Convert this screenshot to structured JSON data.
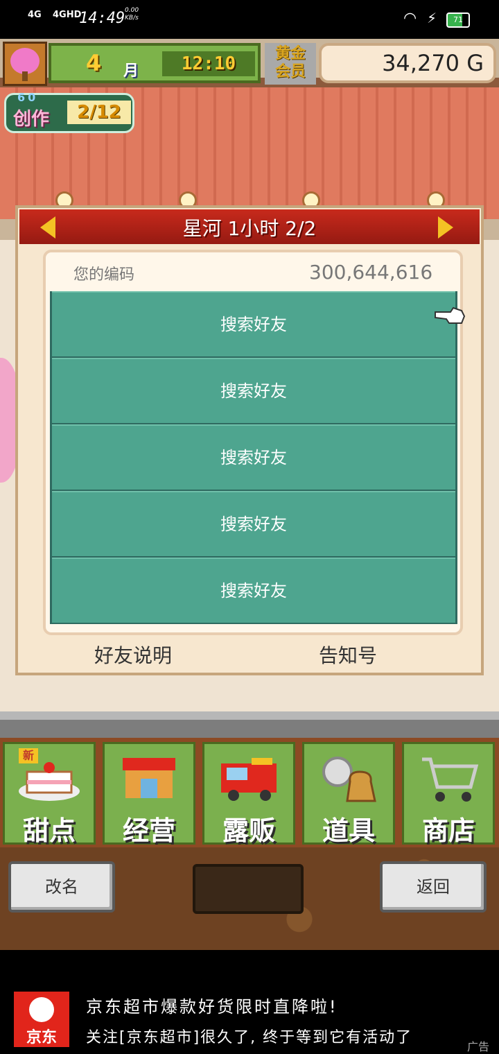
{
  "status_bar": {
    "signal_1": "4G",
    "signal_2": "4GHD",
    "time": "14:49",
    "net_speed": "0.00",
    "net_unit": "KB/s",
    "battery_level": "71"
  },
  "hud": {
    "month_number": "4",
    "month_label": "月",
    "clock": "12:10",
    "gold_member": "黄金\n会员",
    "money": "34,270 G",
    "create_level": "60",
    "create_label": "创作",
    "create_count": "2/12"
  },
  "dialog": {
    "title": "星河 1小时 2/2",
    "code_label": "您的编码",
    "code_value": "300,644,616",
    "rows": [
      "搜索好友",
      "搜索好友",
      "搜索好友",
      "搜索好友",
      "搜索好友"
    ],
    "footer_left": "好友说明",
    "footer_right": "告知号"
  },
  "menu": {
    "new_badge": "新",
    "items": [
      "甜点",
      "经营",
      "露贩",
      "道具",
      "商店"
    ]
  },
  "buttons": {
    "rename": "改名",
    "back": "返回"
  },
  "ad": {
    "logo_text": "京东",
    "line1": "京东超市爆款好货限时直降啦!",
    "line2": "关注[京东超市]很久了, 终于等到它有活动了",
    "tag": "广告"
  },
  "colors": {
    "awning_red": "#e0281e",
    "list_teal": "#4ea58f",
    "menu_green": "#7bb04e",
    "ad_red": "#e1251b"
  }
}
